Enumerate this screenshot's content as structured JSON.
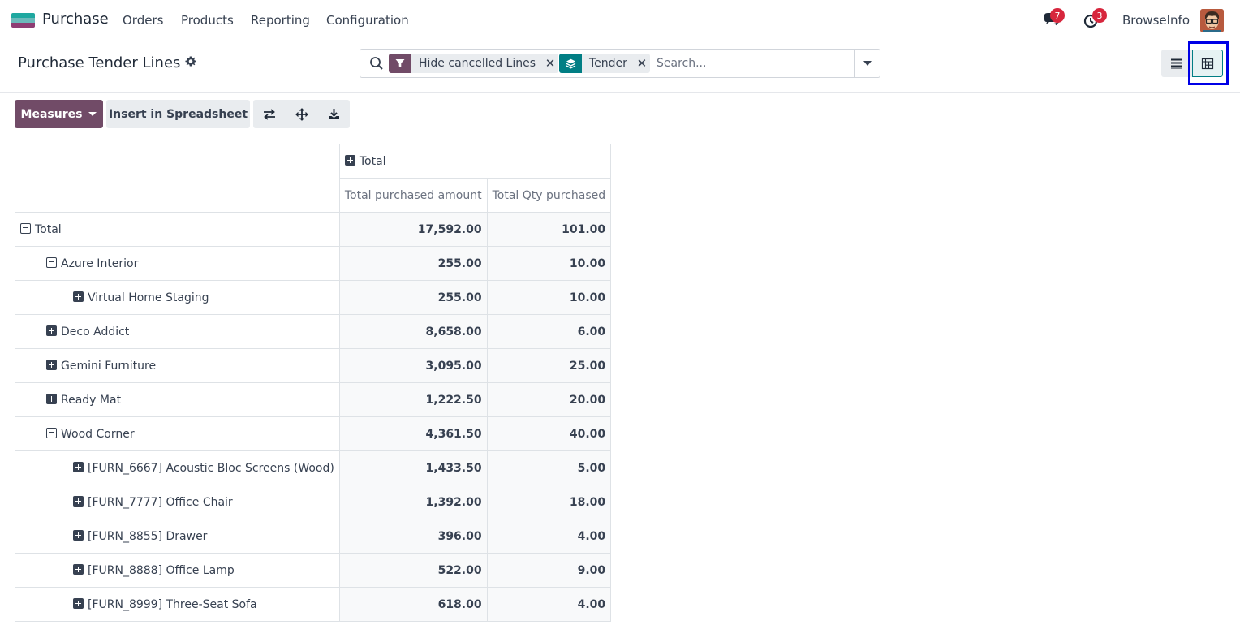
{
  "navbar": {
    "app_name": "Purchase",
    "menu": [
      "Orders",
      "Products",
      "Reporting",
      "Configuration"
    ],
    "messages_badge": "7",
    "activities_badge": "3",
    "user_name": "BrowseInfo",
    "icons": [
      "app-logo",
      "chat-icon",
      "clock-icon",
      "avatar"
    ]
  },
  "control_panel": {
    "title": "Purchase Tender Lines",
    "facets": [
      {
        "label": "Hide cancelled Lines",
        "icon": "filter-icon",
        "color": "#714b67"
      },
      {
        "label": "Tender",
        "icon": "layers-icon",
        "color": "#017e84"
      }
    ],
    "search_placeholder": "Search...",
    "views": [
      "list-view",
      "pivot-view"
    ],
    "active_view": "pivot-view"
  },
  "toolbar": {
    "measures_label": "Measures",
    "insert_label": "Insert in Spreadsheet",
    "icons": [
      "flip-axis-icon",
      "expand-all-icon",
      "download-icon"
    ]
  },
  "pivot": {
    "col_header": "Total",
    "measures": [
      "Total purchased amount",
      "Total Qty purchased"
    ],
    "rows": [
      {
        "label": "Total",
        "level": 0,
        "expanded": true,
        "amount": "17,592.00",
        "qty": "101.00"
      },
      {
        "label": "Azure Interior",
        "level": 1,
        "expanded": true,
        "amount": "255.00",
        "qty": "10.00"
      },
      {
        "label": "Virtual Home Staging",
        "level": 2,
        "expanded": false,
        "amount": "255.00",
        "qty": "10.00"
      },
      {
        "label": "Deco Addict",
        "level": 1,
        "expanded": false,
        "amount": "8,658.00",
        "qty": "6.00"
      },
      {
        "label": "Gemini Furniture",
        "level": 1,
        "expanded": false,
        "amount": "3,095.00",
        "qty": "25.00"
      },
      {
        "label": "Ready Mat",
        "level": 1,
        "expanded": false,
        "amount": "1,222.50",
        "qty": "20.00"
      },
      {
        "label": "Wood Corner",
        "level": 1,
        "expanded": true,
        "amount": "4,361.50",
        "qty": "40.00"
      },
      {
        "label": "[FURN_6667] Acoustic Bloc Screens (Wood)",
        "level": 2,
        "expanded": false,
        "amount": "1,433.50",
        "qty": "5.00"
      },
      {
        "label": "[FURN_7777] Office Chair",
        "level": 2,
        "expanded": false,
        "amount": "1,392.00",
        "qty": "18.00"
      },
      {
        "label": "[FURN_8855] Drawer",
        "level": 2,
        "expanded": false,
        "amount": "396.00",
        "qty": "4.00"
      },
      {
        "label": "[FURN_8888] Office Lamp",
        "level": 2,
        "expanded": false,
        "amount": "522.00",
        "qty": "9.00"
      },
      {
        "label": "[FURN_8999] Three-Seat Sofa",
        "level": 2,
        "expanded": false,
        "amount": "618.00",
        "qty": "4.00"
      }
    ]
  }
}
